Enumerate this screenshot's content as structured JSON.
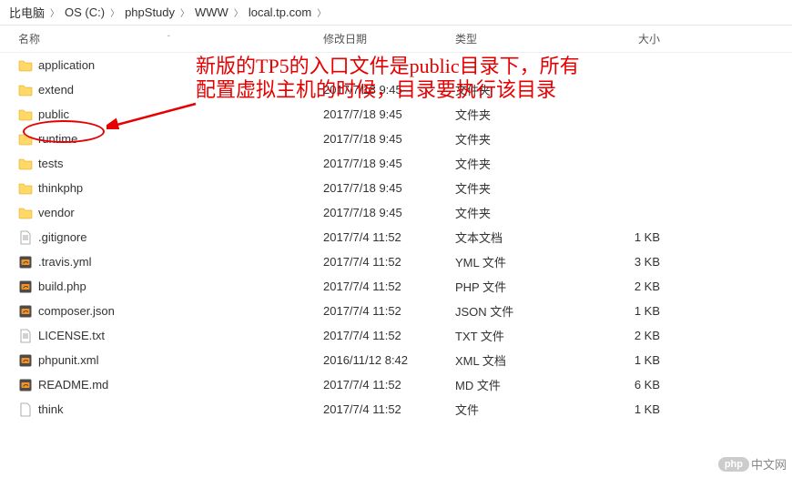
{
  "breadcrumb": {
    "items": [
      "比电脑",
      "OS (C:)",
      "phpStudy",
      "WWW",
      "local.tp.com"
    ]
  },
  "headers": {
    "name": "名称",
    "date": "修改日期",
    "type": "类型",
    "size": "大小"
  },
  "annotation": {
    "line1": "新版的TP5的入口文件是public目录下，所有",
    "line2": "配置虚拟主机的时候，目录要执行该目录"
  },
  "files": [
    {
      "icon": "folder",
      "name": "application",
      "date": "",
      "type": "",
      "size": ""
    },
    {
      "icon": "folder",
      "name": "extend",
      "date": "2017/7/18 9:45",
      "type": "文件夹",
      "size": ""
    },
    {
      "icon": "folder",
      "name": "public",
      "date": "2017/7/18 9:45",
      "type": "文件夹",
      "size": ""
    },
    {
      "icon": "folder",
      "name": "runtime",
      "date": "2017/7/18 9:45",
      "type": "文件夹",
      "size": ""
    },
    {
      "icon": "folder",
      "name": "tests",
      "date": "2017/7/18 9:45",
      "type": "文件夹",
      "size": ""
    },
    {
      "icon": "folder",
      "name": "thinkphp",
      "date": "2017/7/18 9:45",
      "type": "文件夹",
      "size": ""
    },
    {
      "icon": "folder",
      "name": "vendor",
      "date": "2017/7/18 9:45",
      "type": "文件夹",
      "size": ""
    },
    {
      "icon": "text",
      "name": ".gitignore",
      "date": "2017/7/4 11:52",
      "type": "文本文档",
      "size": "1 KB"
    },
    {
      "icon": "sub",
      "name": ".travis.yml",
      "date": "2017/7/4 11:52",
      "type": "YML 文件",
      "size": "3 KB"
    },
    {
      "icon": "sub",
      "name": "build.php",
      "date": "2017/7/4 11:52",
      "type": "PHP 文件",
      "size": "2 KB"
    },
    {
      "icon": "sub",
      "name": "composer.json",
      "date": "2017/7/4 11:52",
      "type": "JSON 文件",
      "size": "1 KB"
    },
    {
      "icon": "text",
      "name": "LICENSE.txt",
      "date": "2017/7/4 11:52",
      "type": "TXT 文件",
      "size": "2 KB"
    },
    {
      "icon": "sub",
      "name": "phpunit.xml",
      "date": "2016/11/12 8:42",
      "type": "XML 文档",
      "size": "1 KB"
    },
    {
      "icon": "sub",
      "name": "README.md",
      "date": "2017/7/4 11:52",
      "type": "MD 文件",
      "size": "6 KB"
    },
    {
      "icon": "blank",
      "name": "think",
      "date": "2017/7/4 11:52",
      "type": "文件",
      "size": "1 KB"
    }
  ],
  "watermark": {
    "badge": "php",
    "text": "中文网"
  }
}
